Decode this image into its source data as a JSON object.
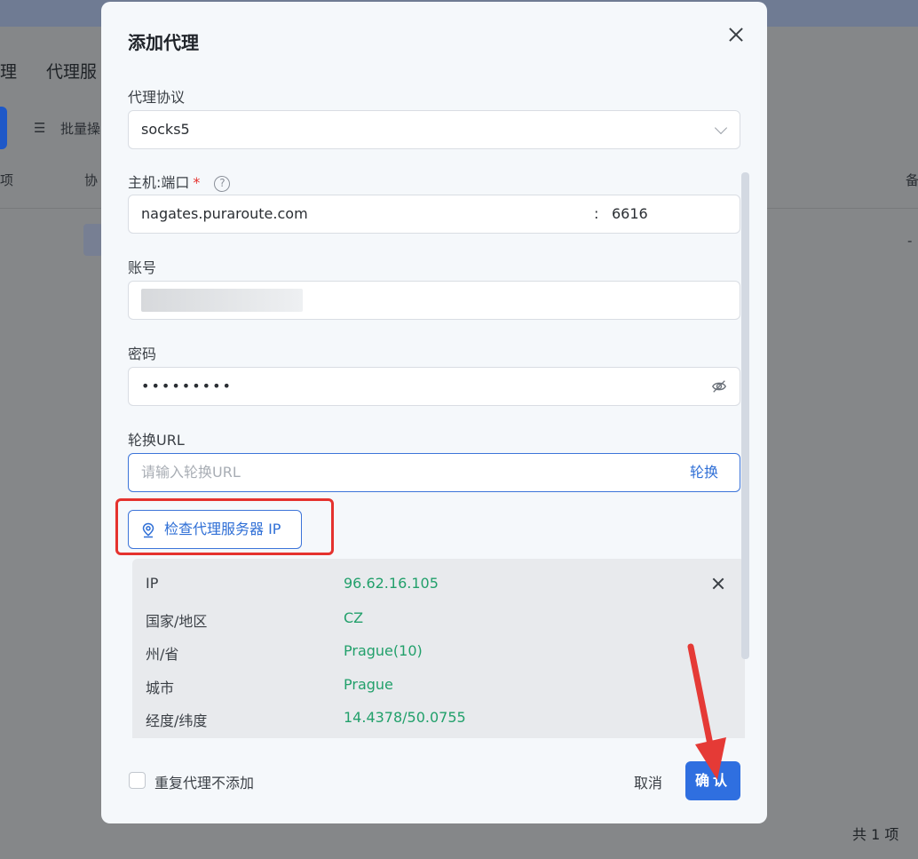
{
  "background": {
    "nav_partial_1": "理",
    "nav_partial_2": "代理服",
    "batch_partial": "批量操",
    "col_partial_1": "项",
    "col_partial_2": "协",
    "col_partial_3": "备",
    "cell_dash": "-",
    "total_count": "共 1 项"
  },
  "modal": {
    "title": "添加代理",
    "protocol_label": "代理协议",
    "protocol_value": "socks5",
    "host_label": "主机:端口",
    "required_mark": "*",
    "host_value": "nagates.puraroute.com",
    "colon": ":",
    "port_value": "6616",
    "account_label": "账号",
    "password_label": "密码",
    "password_value": "•••••••••",
    "rotate_label": "轮换URL",
    "rotate_placeholder": "请输入轮换URL",
    "rotate_button": "轮换",
    "check_button": "检查代理服务器 IP",
    "info": {
      "rows": [
        {
          "key": "IP",
          "value": "96.62.16.105"
        },
        {
          "key": "国家/地区",
          "value": "CZ"
        },
        {
          "key": "州/省",
          "value": "Prague(10)"
        },
        {
          "key": "城市",
          "value": "Prague"
        },
        {
          "key": "经度/纬度",
          "value": "14.4378/50.0755"
        }
      ]
    },
    "dup_checkbox_label": "重复代理不添加",
    "cancel_button": "取消",
    "confirm_button": "确认"
  },
  "colors": {
    "accent": "#2f6fe0",
    "success_text": "#22a06b",
    "highlight_red": "#e5322e"
  }
}
